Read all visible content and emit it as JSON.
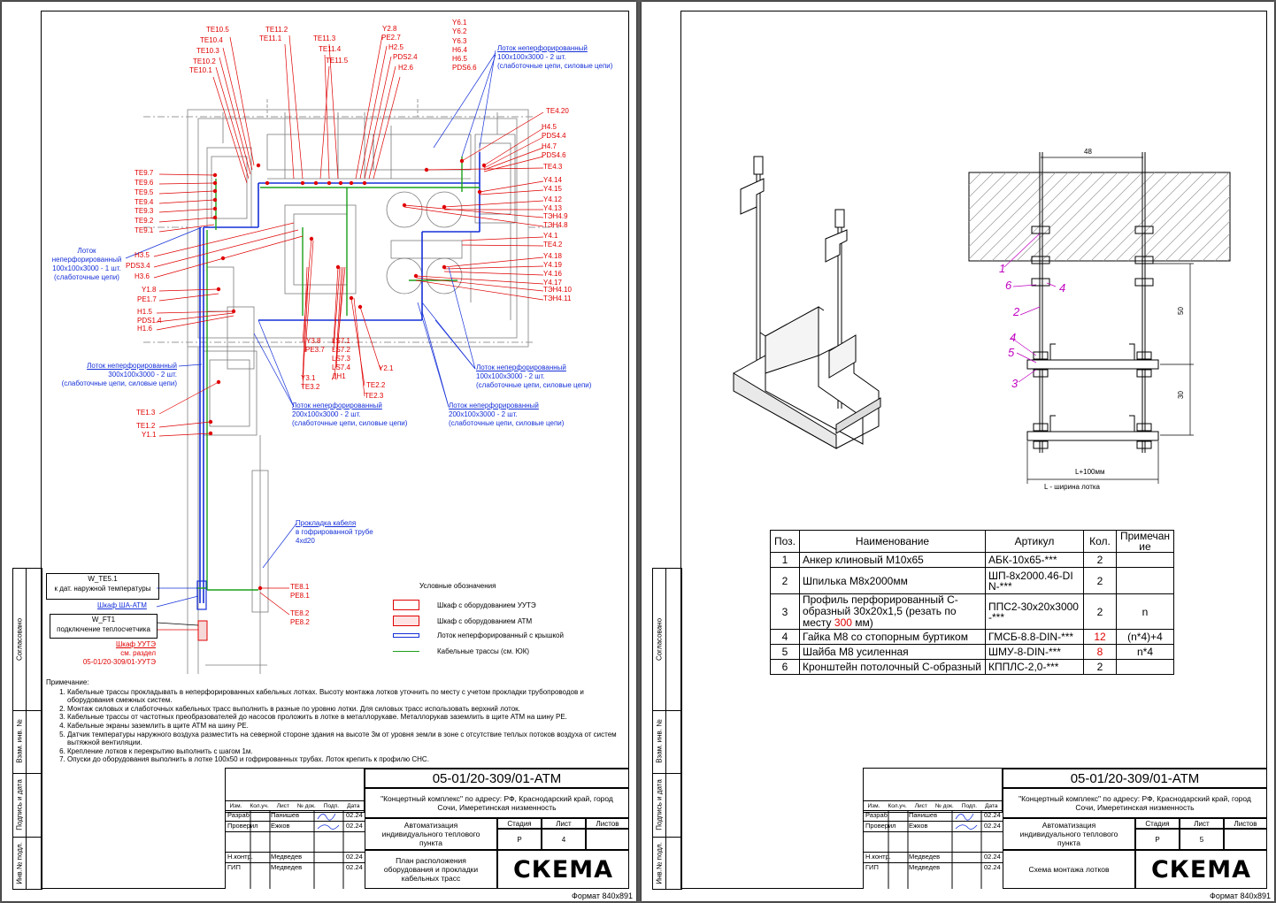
{
  "sheet1": {
    "format": "Формат  840x891",
    "code": "05-01/20-309/01-АТМ",
    "object": "\"Концертный комплекс\" по адресу: РФ, Краснодарский край, город Сочи, Имеретинская низменность",
    "title": "Автоматизация индивидуального теплового пункта",
    "sheet_title": "План расположения оборудования и прокладки кабельных трасс",
    "stage": "Р",
    "sheet_no": "4",
    "logo": "СКЕМА",
    "side_labels": [
      "Согласовано",
      "Взам. инв. №",
      "Подпись и дата",
      "Инв.№ подл."
    ],
    "tb_head": [
      "Изм.",
      "Кол.уч.",
      "Лист",
      "№ док.",
      "Подп.",
      "Дата"
    ],
    "tb_rows": [
      {
        "role": "Разраб.",
        "name": "Панишев",
        "date": "02.24"
      },
      {
        "role": "Проверил",
        "name": "Ежков",
        "date": "02.24"
      },
      {
        "role": "",
        "name": "",
        "date": ""
      },
      {
        "role": "Н.контр.",
        "name": "Медведев",
        "date": "02.24"
      },
      {
        "role": "ГИП",
        "name": "Медведев",
        "date": "02.24"
      }
    ],
    "stage_head": [
      "Стадия",
      "Лист",
      "Листов"
    ],
    "notes_title": "Примечание:",
    "notes": [
      "Кабельные трассы прокладывать в неперфорированных кабельных лотках. Высоту монтажа лотков уточнить по месту с учетом прокладки трубопроводов и оборудования смежных систем.",
      "Монтаж силовых и слаботочных кабельных трасс выполнить в разные по уровню лотки. Для силовых трасс использовать верхний лоток.",
      "Кабельные трассы от частотных преобразователей до насосов проложить в лотке в металлорукаве. Металлорукав заземлить в щите АТМ на шину PE.",
      "Кабельные экраны  заземлить в щите АТМ на шину PE.",
      "Датчик температуры наружного воздуха разместить на северной стороне здания на высоте 3м от уровня земли в зоне с отсутствие теплых потоков воздуха от систем вытяжной вентиляции.",
      "Крепление лотков к перекрытию выполнить с шагом 1м.",
      "Опуски до оборудования выполнить в лотке 100x50 и гофрированных трубах. Лоток крепить к профилю СНС."
    ],
    "legend_title": "Условные обозначения",
    "legend": [
      "Шкаф с оборудованием УУТЭ",
      "Шкаф с оборудованием АТМ",
      "Лоток неперфорированный с крышкой",
      "Кабельные трассы (см. ЮК)"
    ],
    "labels_red_top": [
      "TE10.5",
      "TE10.4",
      "TE10.3",
      "TE10.2",
      "TE10.1",
      "TE11.2",
      "TE11.1",
      "TE11.3",
      "TE11.4",
      "TE11.5",
      "Y2.8",
      "PE2.7",
      "H2.5",
      "PDS2.4",
      "H2.6",
      "Y6.1",
      "Y6.2",
      "Y6.3",
      "H6.4",
      "H6.5",
      "PDS6.6"
    ],
    "labels_red_left": [
      "TE9.7",
      "TE9.6",
      "TE9.5",
      "TE9.4",
      "TE9.3",
      "TE9.2",
      "TE9.1",
      "H3.5",
      "PDS3.4",
      "H3.6",
      "Y1.8",
      "PE1.7",
      "H1.5",
      "PDS1.4",
      "H1.6",
      "TE1.3",
      "TE1.2",
      "Y1.1"
    ],
    "labels_red_right": [
      "TE4.20",
      "H4.5",
      "PDS4.4",
      "H4.7",
      "PDS4.6",
      "TE4.3",
      "Y4.14",
      "Y4.15",
      "Y4.12",
      "Y4.13",
      "ТЭН4.9",
      "ТЭН4.8",
      "Y4.1",
      "TE4.2",
      "Y4.18",
      "Y4.19",
      "Y4.16",
      "Y4.17",
      "ТЭН4.10",
      "ТЭН4.11"
    ],
    "labels_red_bottom": [
      "Y3.8",
      "PE3.7",
      "LS7.1",
      "LS7.2",
      "LS7.3",
      "LS7.4",
      "ДН1",
      "Y2.1",
      "Y3.1",
      "TE3.2",
      "TE2.2",
      "TE2.3",
      "TE8.1",
      "PE8.1",
      "TE8.2",
      "PE8.2"
    ],
    "blue_notes": {
      "tray_top": [
        "Лоток неперфорированный",
        "100x100x3000 - 2 шт.",
        "(слаботочные цепи, силовые цепи)"
      ],
      "tray_left": [
        "Лоток",
        "неперфорированный",
        "100x100x3000 - 1 шт.",
        "(слаботочные цепи)"
      ],
      "tray_mid_left": [
        "Лоток неперфорированный",
        "300x100x3000 - 2 шт.",
        "(слаботочные цепи, силовые цепи)"
      ],
      "tray_bottom1": [
        "Лоток неперфорированный",
        "200x100x3000 - 2 шт.",
        "(слаботочные цепи, силовые цепи)"
      ],
      "tray_right": [
        "Лоток неперфорированный",
        "100x100x3000 - 2 шт.",
        "(слаботочные цепи, силовые цепи)"
      ],
      "tray_bottom2": [
        "Лоток неперфорированный",
        "200x100x3000 - 2 шт.",
        "(слаботочные цепи, силовые цепи)"
      ],
      "cable": [
        "Прокладка кабеля",
        "в гофрированной трубе",
        "4xd20"
      ]
    },
    "callouts": {
      "te51": "W_TE5.1",
      "te51_desc": "к дат. наружной температуры",
      "cabinet_atm": "Шкаф ША-АТМ",
      "ft1": "W_FT1",
      "ft1_desc": "подключение теплосчетчика",
      "cabinet_uute": [
        "Шкаф УУТЭ",
        "см. раздел",
        "05-01/20-309/01-УУТЭ"
      ]
    }
  },
  "sheet2": {
    "format": "Формат  840x891",
    "code": "05-01/20-309/01-АТМ",
    "object": "\"Концертный комплекс\" по адресу: РФ, Краснодарский край, город Сочи, Имеретинская низменность",
    "title": "Автоматизация индивидуального теплового пункта",
    "sheet_title": "Схема монтажа лотков",
    "stage": "Р",
    "sheet_no": "5",
    "logo": "СКЕМА",
    "side_labels": [
      "Согласовано",
      "Взам. инв. №",
      "Подпись и дата",
      "Инв.№ подл."
    ],
    "tb_head": [
      "Изм.",
      "Кол.уч.",
      "Лист",
      "№ док.",
      "Подп.",
      "Дата"
    ],
    "tb_rows": [
      {
        "role": "Разраб.",
        "name": "Панишев",
        "date": "02.24"
      },
      {
        "role": "Проверил",
        "name": "Ежков",
        "date": "02.24"
      },
      {
        "role": "",
        "name": "",
        "date": ""
      },
      {
        "role": "Н.контр.",
        "name": "Медведев",
        "date": "02.24"
      },
      {
        "role": "ГИП",
        "name": "Медведев",
        "date": "02.24"
      }
    ],
    "stage_head": [
      "Стадия",
      "Лист",
      "Листов"
    ],
    "dims": {
      "top": "48",
      "v1": "50",
      "v2": "30",
      "bottom": "L+100мм",
      "caption": "L - ширина лотка"
    },
    "pos_marks": [
      "1",
      "6",
      "4",
      "2",
      "4",
      "5",
      "3"
    ],
    "spec_head": [
      "Поз.",
      "Наименование",
      "Артикул",
      "Кол.",
      "Примечание"
    ],
    "spec_rows": [
      {
        "pos": "1",
        "name": "Анкер клиновый M10x65",
        "art": "АБК-10x65-***",
        "qty": "2",
        "note": ""
      },
      {
        "pos": "2",
        "name": "Шпилька M8x2000мм",
        "art": "ШП-8x2000.46-DIN-***",
        "qty": "2",
        "note": ""
      },
      {
        "pos": "3",
        "name": "Профиль перфорированный С-образный 30x20x1,5 (резать по месту ",
        "name_red": "300",
        "name_tail": " мм)",
        "art": "ППС2-30x20x3000-***",
        "qty": "2",
        "note": "n"
      },
      {
        "pos": "4",
        "name": "Гайка M8 со стопорным буртиком",
        "art": "ГМСБ-8.8-DIN-***",
        "qty": "12",
        "qty_red": true,
        "note": "(n*4)+4"
      },
      {
        "pos": "5",
        "name": "Шайба M8 усиленная",
        "art": "ШМУ-8-DIN-***",
        "qty": "8",
        "qty_red": true,
        "note": "n*4"
      },
      {
        "pos": "6",
        "name": "Кронштейн потолочный С-образный",
        "art": "КППЛС-2,0-***",
        "qty": "2",
        "note": ""
      }
    ]
  }
}
